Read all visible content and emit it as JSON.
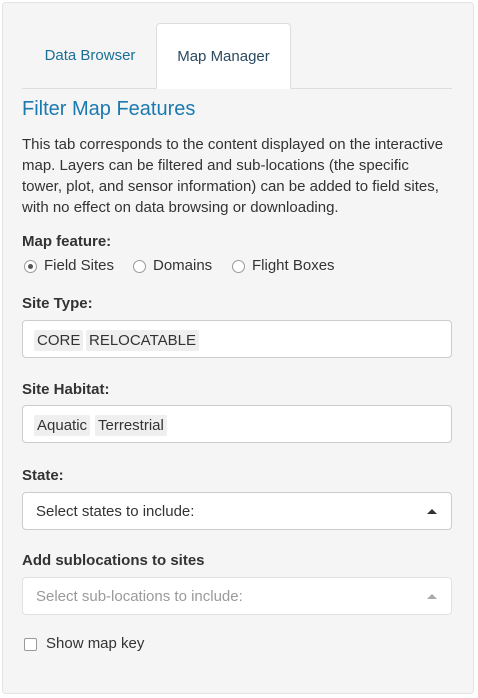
{
  "tabs": [
    {
      "label": "Data Browser",
      "active": false
    },
    {
      "label": "Map Manager",
      "active": true
    }
  ],
  "section": {
    "title": "Filter Map Features",
    "description": "This tab corresponds to the content displayed on the interactive map. Layers can be filtered and sub-locations (the specific tower, plot, and sensor information) can be added to field sites, with no effect on data browsing or downloading."
  },
  "map_feature": {
    "label": "Map feature:",
    "options": [
      "Field Sites",
      "Domains",
      "Flight Boxes"
    ],
    "selected": "Field Sites"
  },
  "site_type": {
    "label": "Site Type:",
    "selected": [
      "CORE",
      "RELOCATABLE"
    ]
  },
  "site_habitat": {
    "label": "Site Habitat:",
    "selected": [
      "Aquatic",
      "Terrestrial"
    ]
  },
  "state": {
    "label": "State:",
    "placeholder": "Select states to include:"
  },
  "sublocations": {
    "label": "Add sublocations to sites",
    "placeholder": "Select sub-locations to include:"
  },
  "map_key": {
    "label": "Show map key",
    "checked": false
  },
  "colors": {
    "accent": "#1a7ab0",
    "tab_link": "#1a6f96",
    "panel_bg": "#f5f5f5"
  }
}
